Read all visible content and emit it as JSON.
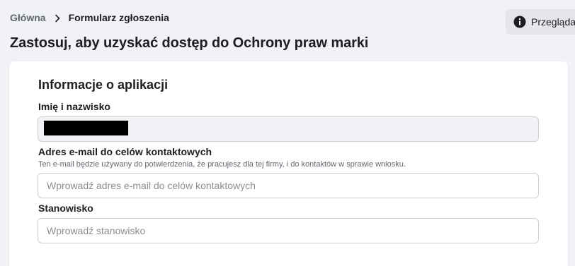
{
  "breadcrumb": {
    "home": "Główna",
    "current": "Formularz zgłoszenia"
  },
  "header": {
    "title": "Zastosuj, aby uzyskać dostęp do Ochrony praw marki",
    "preview_label": "Przeglądaj"
  },
  "form": {
    "section_title": "Informacje o aplikacji",
    "name": {
      "label": "Imię i nazwisko",
      "value": ""
    },
    "email": {
      "label": "Adres e-mail do celów kontaktowych",
      "help": "Ten e-mail będzie używany do potwierdzenia, że pracujesz dla tej firmy, i do kontaktów w sprawie wniosku.",
      "placeholder": "Wprowadź adres e-mail do celów kontaktowych"
    },
    "position": {
      "label": "Stanowisko",
      "placeholder": "Wprowadź stanowisko"
    }
  },
  "icons": {
    "breadcrumb_separator": "chevron-right-icon",
    "preview": "info-icon"
  }
}
